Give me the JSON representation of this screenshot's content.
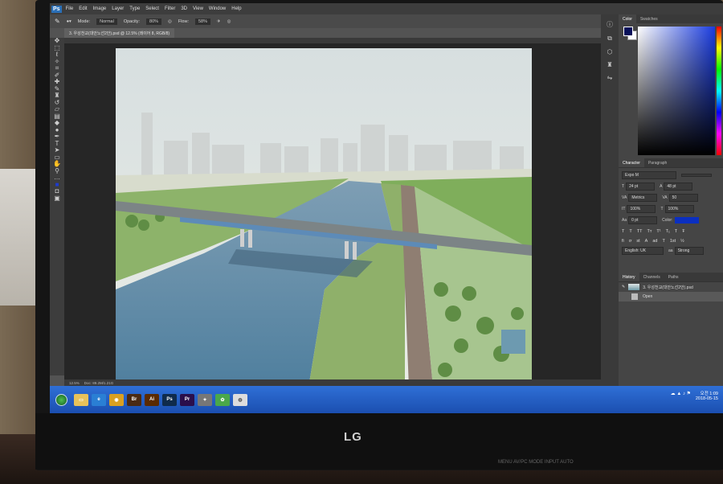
{
  "menubar": {
    "app_logo": "Ps",
    "items": [
      "File",
      "Edit",
      "Image",
      "Layer",
      "Type",
      "Select",
      "Filter",
      "3D",
      "View",
      "Window",
      "Help"
    ]
  },
  "options_bar": {
    "mode_label": "Mode:",
    "mode_value": "Normal",
    "opacity_label": "Opacity:",
    "opacity_value": "80%",
    "flow_label": "Flow:",
    "flow_value": "58%"
  },
  "document": {
    "tab_title": "3. 우성천교(대안노선2안).psd @ 12.5% (레이어 8, RGB/8)",
    "zoom": "12.5%",
    "doc_size": "Doc: 89.2M/1.21G"
  },
  "panels": {
    "color_tabs": [
      "Color",
      "Swatches"
    ],
    "character_tabs": [
      "Character",
      "Paragraph"
    ],
    "font_family": "Expo M",
    "font_size": "24 pt",
    "leading": "48 pt",
    "kerning": "Metrics",
    "tracking": "50",
    "vertical_scale": "100%",
    "horizontal_scale": "100%",
    "baseline_shift": "0 pt",
    "color_label": "Color:",
    "color_value": "#0b2fc0",
    "language": "English: UK",
    "antialias": "Strong",
    "history_tabs": [
      "History",
      "Channels",
      "Paths"
    ],
    "history_items": [
      {
        "label": "3. 우성천교(대안노선2안).psd",
        "type": "snapshot"
      },
      {
        "label": "Open",
        "type": "step"
      }
    ]
  },
  "taskbar": {
    "apps": [
      {
        "name": "explorer",
        "label": "",
        "color": "#e8c25a"
      },
      {
        "name": "ie",
        "label": "e",
        "color": "#2a7fd4"
      },
      {
        "name": "chrome",
        "label": "",
        "color": "#d9a021"
      },
      {
        "name": "bridge",
        "label": "Br",
        "color": "#4a2a12"
      },
      {
        "name": "illustrator",
        "label": "Ai",
        "color": "#5a2a00"
      },
      {
        "name": "photoshop",
        "label": "Ps",
        "color": "#0f2b4c"
      },
      {
        "name": "premiere",
        "label": "Pr",
        "color": "#2a0f4c"
      },
      {
        "name": "app1",
        "label": "",
        "color": "#777"
      },
      {
        "name": "app2",
        "label": "",
        "color": "#4aa84a"
      },
      {
        "name": "app3",
        "label": "",
        "color": "#ddd"
      }
    ],
    "time": "오전 1:09",
    "date": "2018-05-15"
  },
  "monitor": {
    "brand": "LG",
    "buttons": "MENU  AV/PC  MODE  INPUT  AUTO"
  }
}
